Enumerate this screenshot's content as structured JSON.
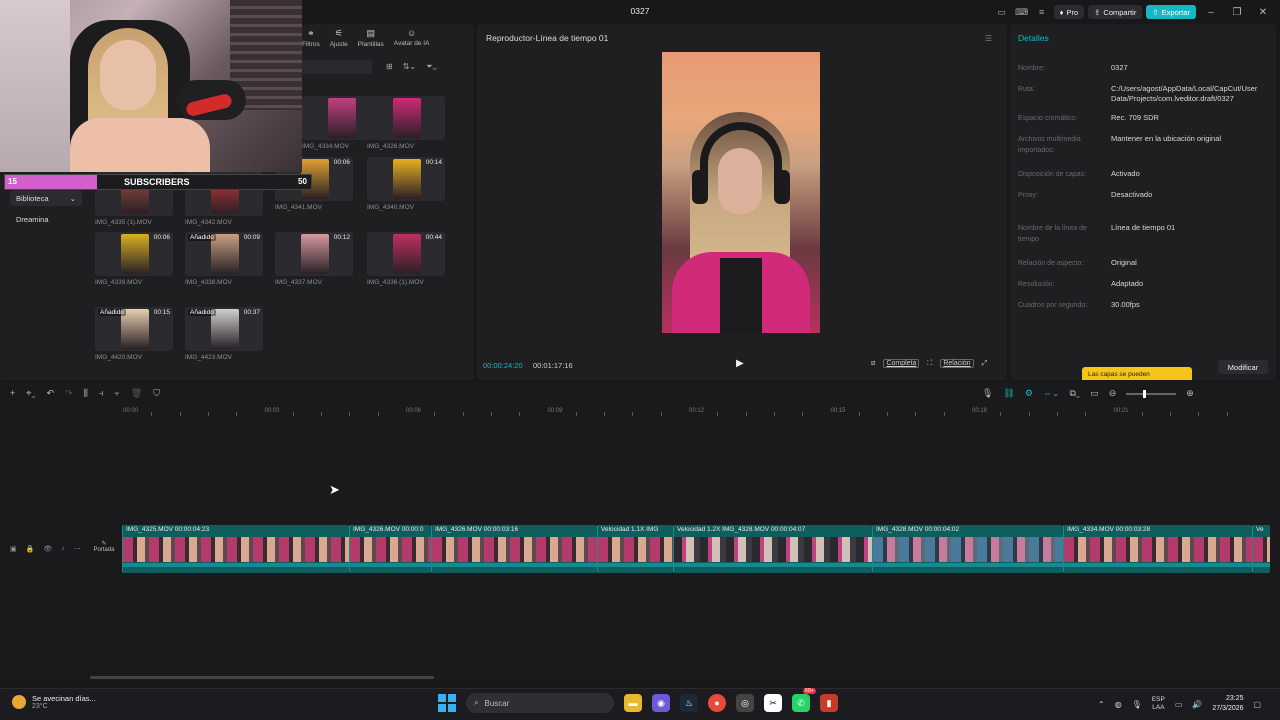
{
  "window": {
    "title": "0327",
    "pro_label": "Pro",
    "share_label": "Compartir",
    "export_label": "Exportar"
  },
  "media": {
    "toptabs": [
      {
        "label": "Filtros",
        "icon": "filters-icon"
      },
      {
        "label": "Ajuste",
        "icon": "adjust-icon"
      },
      {
        "label": "Plantillas",
        "icon": "templates-icon"
      },
      {
        "label": "Avatar de IA",
        "icon": "ai-avatar-icon"
      }
    ],
    "sidebar": [
      {
        "label": "Biblioteca"
      },
      {
        "label": "Dreamina"
      }
    ],
    "thumbs": [
      {
        "name": "IMG_4334.MOV",
        "duration": "",
        "added": ""
      },
      {
        "name": "IMG_4326.MOV",
        "duration": "",
        "added": ""
      },
      {
        "name": "IMG_4335 (1).MOV",
        "duration": "",
        "added": ""
      },
      {
        "name": "IMG_4342.MOV",
        "duration": "",
        "added": ""
      },
      {
        "name": "IMG_4341.MOV",
        "duration": "00:06",
        "added": ""
      },
      {
        "name": "IMG_4340.MOV",
        "duration": "00:14",
        "added": ""
      },
      {
        "name": "IMG_4339.MOV",
        "duration": "00:06",
        "added": ""
      },
      {
        "name": "IMG_4338.MOV",
        "duration": "00:09",
        "added": "Añadido"
      },
      {
        "name": "IMG_4337.MOV",
        "duration": "00:12",
        "added": ""
      },
      {
        "name": "IMG_4336 (1).MOV",
        "duration": "00:44",
        "added": ""
      },
      {
        "name": "IMG_4420.MOV",
        "duration": "00:15",
        "added": "Añadido"
      },
      {
        "name": "IMG_4423.MOV",
        "duration": "00:37",
        "added": "Añadido"
      }
    ]
  },
  "overlay": {
    "sub_count": "15",
    "sub_label": "SUBSCRIBERS",
    "sub_goal": "50",
    "sub_progress": 0.3
  },
  "player": {
    "title": "Reproductor-Línea de tiempo 01",
    "time_current": "00:00:24:20",
    "time_total": "00:01:17:16",
    "full_label": "Completa",
    "ratio_label": "Relación"
  },
  "details": {
    "heading": "Detalles",
    "rows": [
      {
        "k": "Nombre:",
        "v": "0327"
      },
      {
        "k": "Ruta:",
        "v": "C:/Users/agost/AppData/Local/CapCut/User Data/Projects/com.lveditor.draft/0327"
      },
      {
        "k": "Espacio cromático:",
        "v": "Rec. 709 SDR"
      },
      {
        "k": "Archivos multimedia importados:",
        "v": "Mantener en la ubicación original"
      },
      {
        "k": "Disposición de capas:",
        "v": "Activado"
      },
      {
        "k": "Proxy:",
        "v": "Desactivado"
      },
      {
        "k": "Nombre de la línea de tiempo",
        "v": "Línea de tiempo 01"
      },
      {
        "k": "Relación de aspecto:",
        "v": "Original"
      },
      {
        "k": "Resolución:",
        "v": "Adaptado"
      },
      {
        "k": "Cuadros por segundo:",
        "v": "30.00fps"
      }
    ],
    "tooltip": "Las capas se pueden",
    "modify_label": "Modificar"
  },
  "timeline": {
    "ticks": [
      "00:00",
      "00:03",
      "00:06",
      "00:09",
      "00:12",
      "00:15",
      "00:18",
      "00:21"
    ],
    "cover_label": "Portada",
    "clips": [
      {
        "label": "IMG_4325.MOV  00:00:04:23",
        "style": "pink"
      },
      {
        "label": "IMG_4326.MOV  00:00:0",
        "style": "pink"
      },
      {
        "label": "IMG_4326.MOV  00:00:03:16",
        "style": "pink"
      },
      {
        "label": "Velocidad 1.1X  IMG",
        "style": "pink"
      },
      {
        "label": "Velocidad 1.2X  IMG_4328.MOV  00:00:04:07",
        "style": "dark"
      },
      {
        "label": "IMG_4328.MOV  00:00:04:02",
        "style": "blue"
      },
      {
        "label": "IMG_4334.MOV  00:00:03:28",
        "style": "pink"
      },
      {
        "label": "Ve",
        "style": "pink"
      }
    ]
  },
  "taskbar": {
    "weather_text": "Se avecinan días...",
    "temperature": "23°C",
    "search_placeholder": "Buscar",
    "badge": "99+",
    "lang_1": "ESP",
    "lang_2": "LAA",
    "time": "23:25",
    "date": "27/3/2026"
  }
}
